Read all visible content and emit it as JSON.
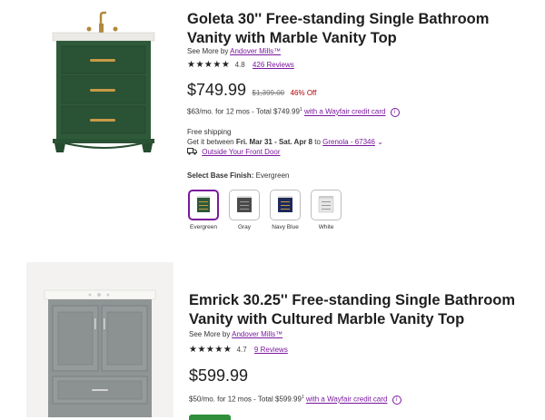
{
  "products": [
    {
      "title_line1": "Goleta 30'' Free-standing Single Bathroom",
      "title_line2": "Vanity with Marble Vanity Top",
      "see_more_prefix": "See More by",
      "brand": "Andover Mills™",
      "rating": "4.8",
      "reviews": "426 Reviews",
      "price": "$749.99",
      "was_price": "$1,399.00",
      "discount": "46% Off",
      "financing_prefix": "$63/mo. for 12 mos - Total $749.99",
      "financing_sup": "1",
      "financing_link": "with a Wayfair credit card",
      "shipping": "Free shipping",
      "delivery_prefix": "Get it between",
      "delivery_dates": "Fri. Mar 31 - Sat. Apr 8",
      "delivery_to": "to",
      "zip": "Grenola - 67346",
      "outside_door": "Outside Your Front Door",
      "finish_label": "Select Base Finish:",
      "finish_value": "Evergreen",
      "swatches": [
        {
          "label": "Evergreen",
          "color": "#2f5a3a"
        },
        {
          "label": "Gray",
          "color": "#4b4b4b"
        },
        {
          "label": "Navy Blue",
          "color": "#1e2a5a"
        },
        {
          "label": "White",
          "color": "#e8e8e8"
        }
      ]
    },
    {
      "title_line1": "Emrick 30.25'' Free-standing Single Bathroom",
      "title_line2": "Vanity with Cultured Marble Vanity Top",
      "see_more_prefix": "See More by",
      "brand": "Andover Mills™",
      "rating": "4.7",
      "reviews": "9 Reviews",
      "price": "$599.99",
      "financing_prefix": "$50/mo. for 12 mos - Total $599.99",
      "financing_sup": "1",
      "financing_link": "with a Wayfair credit card"
    }
  ],
  "colors": {
    "accent": "#7b189f",
    "vanity_green": "#2f5a3a",
    "vanity_gray": "#8f9495"
  }
}
